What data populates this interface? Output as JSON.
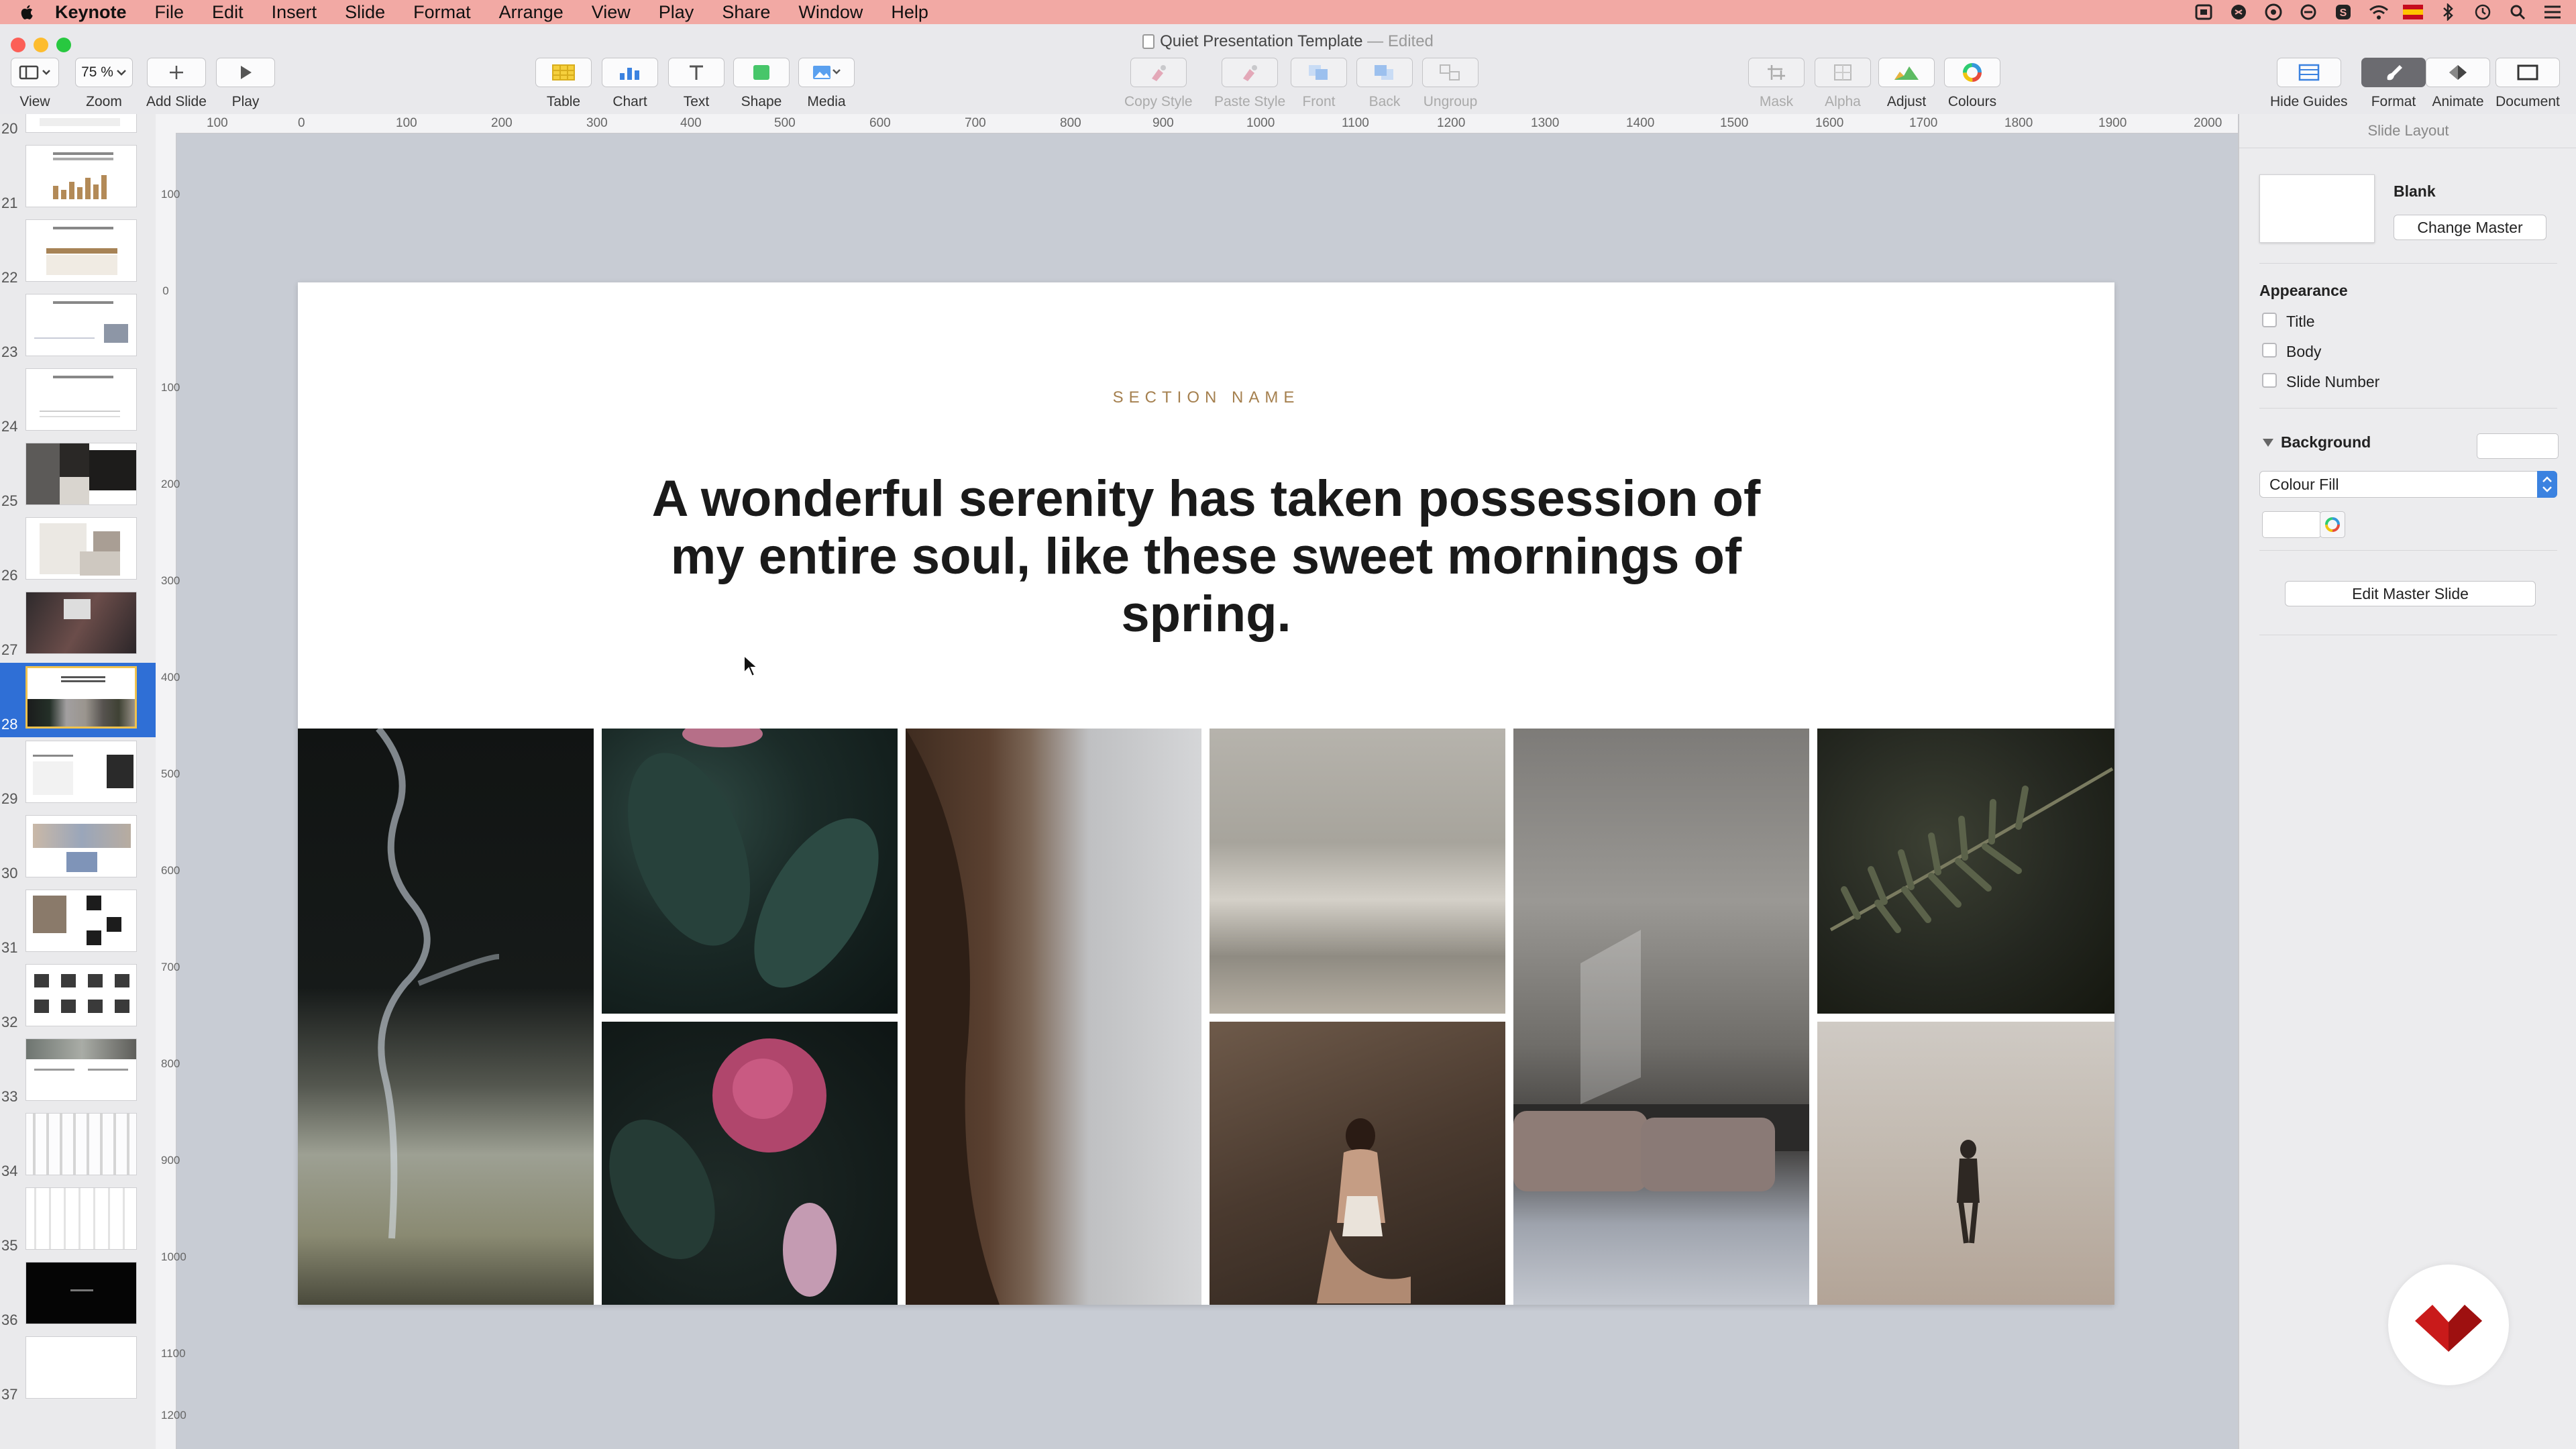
{
  "menubar": {
    "items": [
      "Keynote",
      "File",
      "Edit",
      "Insert",
      "Slide",
      "Format",
      "Arrange",
      "View",
      "Play",
      "Share",
      "Window",
      "Help"
    ],
    "tray_icons": [
      "screen-record-icon",
      "bluetooth-app-icon",
      "tool-app-icon",
      "vpn-icon",
      "skype-icon",
      "wifi-icon",
      "flag-icon",
      "bluetooth-icon",
      "time-machine-icon",
      "spotlight-icon",
      "control-icon"
    ]
  },
  "window": {
    "title": "Quiet Presentation Template",
    "status": "— Edited"
  },
  "toolbar": {
    "view": "View",
    "zoom_value": "75 %",
    "zoom": "Zoom",
    "add_slide": "Add Slide",
    "play": "Play",
    "table": "Table",
    "chart": "Chart",
    "text": "Text",
    "shape": "Shape",
    "media": "Media",
    "copy_style": "Copy Style",
    "paste_style": "Paste Style",
    "front": "Front",
    "back": "Back",
    "ungroup": "Ungroup",
    "mask": "Mask",
    "alpha": "Alpha",
    "adjust": "Adjust",
    "colours": "Colours",
    "hide_guides": "Hide Guides",
    "format": "Format",
    "animate": "Animate",
    "document": "Document"
  },
  "navigator": {
    "slides": [
      "20",
      "21",
      "22",
      "23",
      "24",
      "25",
      "26",
      "27",
      "28",
      "29",
      "30",
      "31",
      "32",
      "33",
      "34",
      "35",
      "36",
      "37"
    ],
    "selected": "28"
  },
  "ruler": {
    "h": [
      "100",
      "0",
      "100",
      "200",
      "300",
      "400",
      "500",
      "600",
      "700",
      "800",
      "900",
      "1000",
      "1100",
      "1200",
      "1300",
      "1400",
      "1500",
      "1600",
      "1700",
      "1800",
      "1900",
      "2000"
    ],
    "v": [
      "100",
      "0",
      "100",
      "200",
      "300",
      "400",
      "500",
      "600",
      "700",
      "800",
      "900",
      "1000",
      "1100",
      "1200"
    ]
  },
  "slide": {
    "section": "SECTION NAME",
    "headline": "A wonderful serenity has taken possession of my entire soul, like these sweet mornings of spring."
  },
  "inspector": {
    "header": "Slide Layout",
    "master_name": "Blank",
    "change_master": "Change Master",
    "appearance": "Appearance",
    "opt_title": "Title",
    "opt_body": "Body",
    "opt_slide_number": "Slide Number",
    "background": "Background",
    "fill": "Colour Fill",
    "edit_master": "Edit Master Slide"
  },
  "colors": {
    "menubar": "#f2a9a4",
    "accent": "#a5804f",
    "selection": "#2f6fd6",
    "brand": "#c91a1a"
  }
}
